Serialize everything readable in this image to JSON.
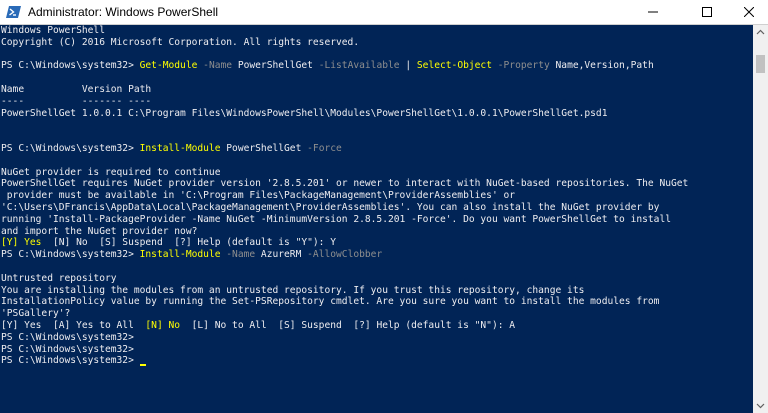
{
  "window": {
    "title": "Administrator: Windows PowerShell",
    "icon": "powershell-icon"
  },
  "colors": {
    "console_bg": "#012456",
    "console_fg": "#eeedf0",
    "command_yellow": "#ffff00",
    "parameter_gray": "#8e8e8e"
  },
  "console": {
    "line01": "Windows PowerShell",
    "line02": "Copyright (C) 2016 Microsoft Corporation. All rights reserved.",
    "line04": {
      "prompt": "PS C:\\Windows\\system32> ",
      "cmd1": "Get-Module",
      "p1": " -Name",
      "a1": " PowerShellGet",
      "p2": " -ListAvailable",
      "pipe": " | ",
      "cmd2": "Select-Object",
      "p3": " -Property",
      "a2": " Name,Version,Path"
    },
    "line06": "Name          Version Path",
    "line07": "----          ------- ----",
    "line08": "PowerShellGet 1.0.0.1 C:\\Program Files\\WindowsPowerShell\\Modules\\PowerShellGet\\1.0.0.1\\PowerShellGet.psd1",
    "line11": {
      "prompt": "PS C:\\Windows\\system32> ",
      "cmd": "Install-Module",
      "arg": " PowerShellGet",
      "param": " -Force"
    },
    "line13": "NuGet provider is required to continue",
    "line14": "PowerShellGet requires NuGet provider version '2.8.5.201' or newer to interact with NuGet-based repositories. The NuGet",
    "line15": " provider must be available in 'C:\\Program Files\\PackageManagement\\ProviderAssemblies' or",
    "line16": "'C:\\Users\\DFrancis\\AppData\\Local\\PackageManagement\\ProviderAssemblies'. You can also install the NuGet provider by",
    "line17": "running 'Install-PackageProvider -Name NuGet -MinimumVersion 2.8.5.201 -Force'. Do you want PowerShellGet to install",
    "line18": "and import the NuGet provider now?",
    "line19": {
      "default_choice": "[Y] Yes",
      "rest": "  [N] No  [S] Suspend  [?] Help (default is \"Y\"): Y"
    },
    "line20": {
      "prompt": "PS C:\\Windows\\system32> ",
      "cmd": "Install-Module",
      "p1": " -Name",
      "arg": " AzureRM",
      "p2": " -AllowClobber"
    },
    "line22": "Untrusted repository",
    "line23": "You are installing the modules from an untrusted repository. If you trust this repository, change its",
    "line24": "InstallationPolicy value by running the Set-PSRepository cmdlet. Are you sure you want to install the modules from",
    "line25": "'PSGallery'?",
    "line26": {
      "before": "[Y] Yes  [A] Yes to All  ",
      "default_choice": "[N] No",
      "after": "  [L] No to All  [S] Suspend  [?] Help (default is \"N\"): A"
    },
    "line27": "PS C:\\Windows\\system32>",
    "line28": "PS C:\\Windows\\system32>",
    "line29": "PS C:\\Windows\\system32> "
  }
}
